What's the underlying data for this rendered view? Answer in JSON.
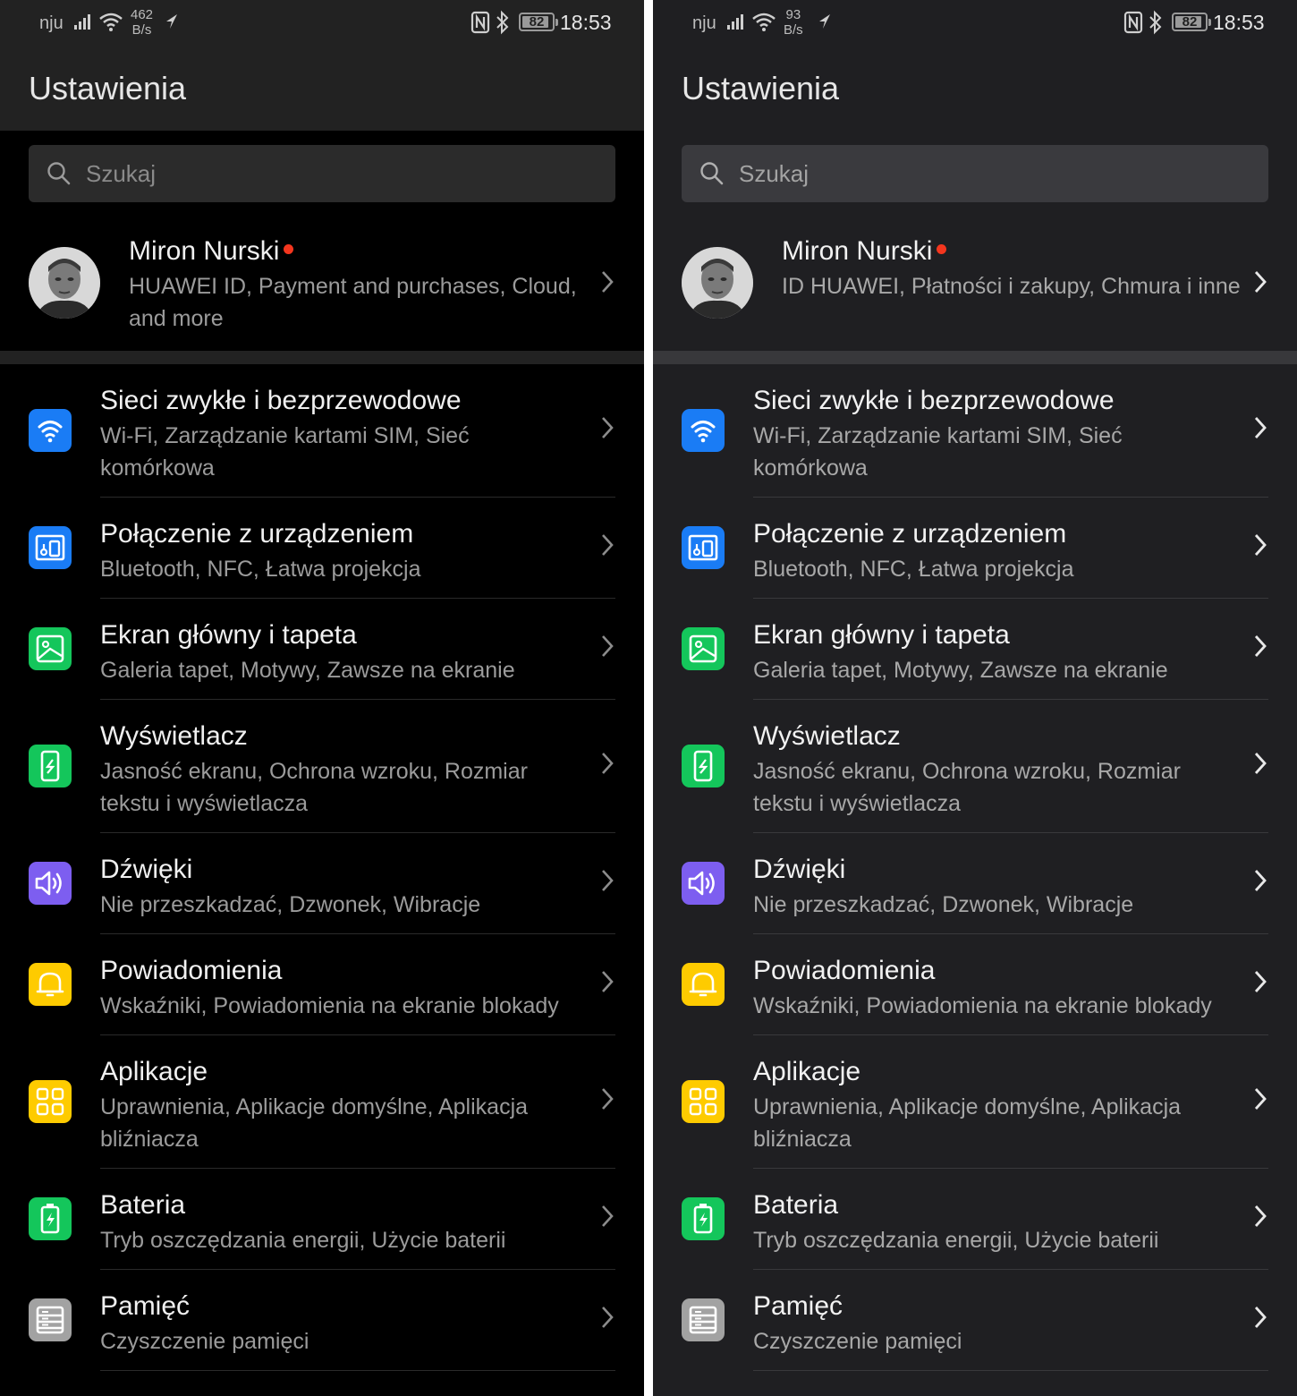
{
  "colors": {
    "wifi_blue": "#1a7cf5",
    "connect_blue": "#1a7cf5",
    "home_green": "#14c65b",
    "display_green": "#14c65b",
    "sound_purple": "#7d5ef0",
    "notify_yellow": "#fecb00",
    "apps_yellow": "#fecb00",
    "battery_green": "#14c65b",
    "storage_grey": "#a2a2a2",
    "notification_dot": "#f4361e"
  },
  "screens": [
    {
      "status": {
        "carrier": "nju",
        "speed_top": "462",
        "speed_bottom": "B/s",
        "battery": "82",
        "time": "18:53"
      },
      "title": "Ustawienia",
      "search": {
        "placeholder": "Szukaj"
      },
      "profile": {
        "name": "Miron Nurski",
        "desc": "HUAWEI ID, Payment and purchases, Cloud, and more"
      },
      "items": [
        {
          "title": "Sieci zwykłe i bezprzewodowe",
          "sub": "Wi-Fi, Zarządzanie kartami SIM, Sieć komórkowa",
          "icon": "wifi-icon"
        },
        {
          "title": "Połączenie z urządzeniem",
          "sub": "Bluetooth, NFC, Łatwa projekcja",
          "icon": "device-connection-icon"
        },
        {
          "title": "Ekran główny i tapeta",
          "sub": "Galeria tapet, Motywy, Zawsze na ekranie",
          "icon": "wallpaper-icon"
        },
        {
          "title": "Wyświetlacz",
          "sub": "Jasność ekranu, Ochrona wzroku, Rozmiar tekstu i wyświetlacza",
          "icon": "display-icon"
        },
        {
          "title": "Dźwięki",
          "sub": "Nie przeszkadzać, Dzwonek, Wibracje",
          "icon": "speaker-icon"
        },
        {
          "title": "Powiadomienia",
          "sub": "Wskaźniki, Powiadomienia na ekranie blokady",
          "icon": "bell-icon"
        },
        {
          "title": "Aplikacje",
          "sub": "Uprawnienia, Aplikacje domyślne, Aplikacja bliźniacza",
          "icon": "apps-grid-icon"
        },
        {
          "title": "Bateria",
          "sub": "Tryb oszczędzania energii, Użycie baterii",
          "icon": "battery-icon"
        },
        {
          "title": "Pamięć",
          "sub": "Czyszczenie pamięci",
          "icon": "storage-icon"
        }
      ]
    },
    {
      "status": {
        "carrier": "nju",
        "speed_top": "93",
        "speed_bottom": "B/s",
        "battery": "82",
        "time": "18:53"
      },
      "title": "Ustawienia",
      "search": {
        "placeholder": "Szukaj"
      },
      "profile": {
        "name": "Miron Nurski",
        "desc": "ID HUAWEI, Płatności i zakupy, Chmura i inne"
      },
      "items": [
        {
          "title": "Sieci zwykłe i bezprzewodowe",
          "sub": "Wi-Fi, Zarządzanie kartami SIM, Sieć komórkowa",
          "icon": "wifi-icon"
        },
        {
          "title": "Połączenie z urządzeniem",
          "sub": "Bluetooth, NFC, Łatwa projekcja",
          "icon": "device-connection-icon"
        },
        {
          "title": "Ekran główny i tapeta",
          "sub": "Galeria tapet, Motywy, Zawsze na ekranie",
          "icon": "wallpaper-icon"
        },
        {
          "title": "Wyświetlacz",
          "sub": "Jasność ekranu, Ochrona wzroku, Rozmiar tekstu i wyświetlacza",
          "icon": "display-icon"
        },
        {
          "title": "Dźwięki",
          "sub": "Nie przeszkadzać, Dzwonek, Wibracje",
          "icon": "speaker-icon"
        },
        {
          "title": "Powiadomienia",
          "sub": "Wskaźniki, Powiadomienia na ekranie blokady",
          "icon": "bell-icon"
        },
        {
          "title": "Aplikacje",
          "sub": "Uprawnienia, Aplikacje domyślne, Aplikacja bliźniacza",
          "icon": "apps-grid-icon"
        },
        {
          "title": "Bateria",
          "sub": "Tryb oszczędzania energii, Użycie baterii",
          "icon": "battery-icon"
        },
        {
          "title": "Pamięć",
          "sub": "Czyszczenie pamięci",
          "icon": "storage-icon"
        }
      ]
    }
  ]
}
